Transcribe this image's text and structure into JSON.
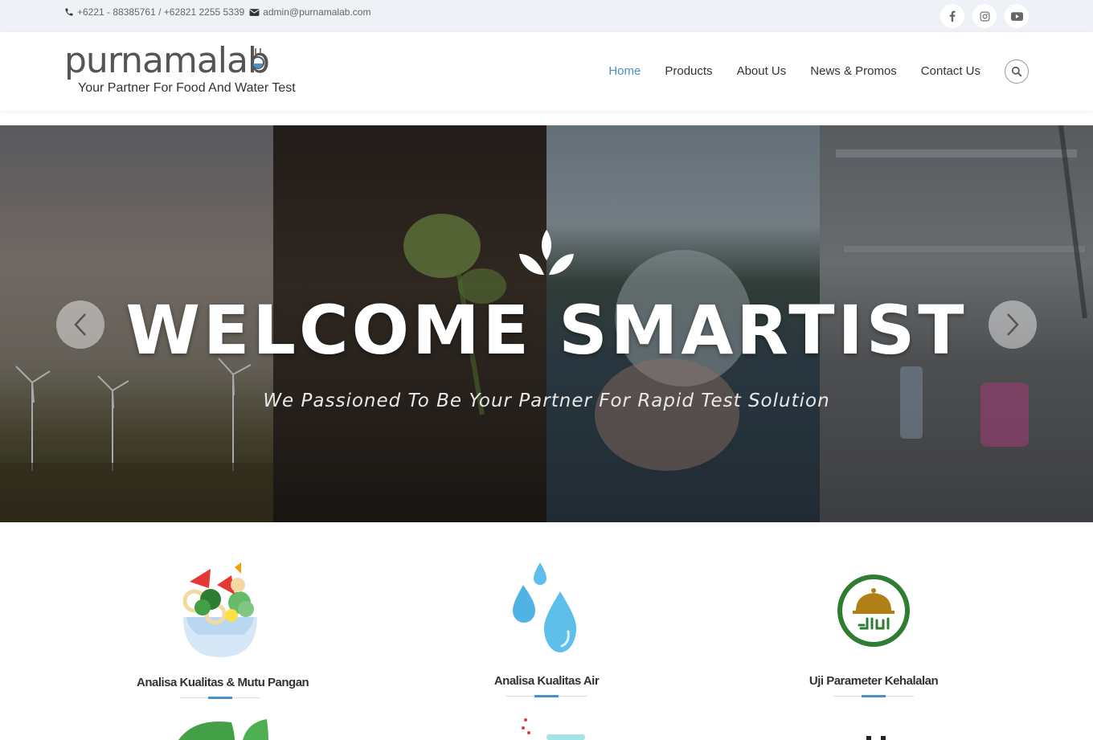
{
  "topbar": {
    "phone": "+6221 - 88385761 / +62821 2255 5339",
    "email": "admin@purnamalab.com",
    "social": [
      "facebook-icon",
      "instagram-icon",
      "youtube-icon"
    ]
  },
  "header": {
    "logo_word": "purnamalab",
    "logo_tagline": "Your Partner For Food And Water Test",
    "nav": [
      "Home",
      "Products",
      "About Us",
      "News & Promos",
      "Contact Us"
    ],
    "active_nav": "Home"
  },
  "hero": {
    "title": "WELCOME SMARTIST",
    "subtitle": "We Passioned To Be Your Partner For Rapid Test Solution"
  },
  "services": [
    {
      "title": "Analisa Kualitas & Mutu Pangan",
      "icon": "salad-bowl-icon"
    },
    {
      "title": "Analisa Kualitas Air",
      "icon": "water-drops-icon"
    },
    {
      "title": "Uji Parameter Kehalalan",
      "icon": "halal-icon"
    }
  ],
  "colors": {
    "accent": "#4a90c8",
    "topbar_bg": "#eef1f5",
    "halal_green": "#2e7d32"
  }
}
